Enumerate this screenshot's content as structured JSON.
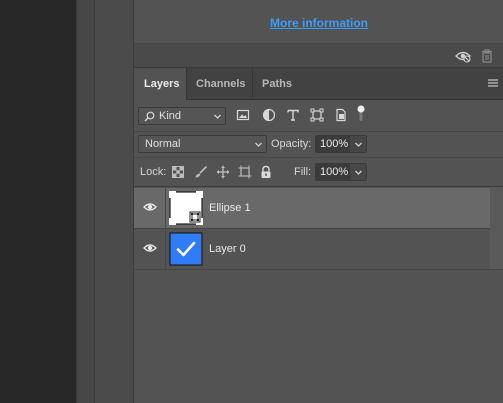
{
  "more_info_link": "More information",
  "tabs": [
    {
      "label": "Layers",
      "active": true
    },
    {
      "label": "Channels",
      "active": false
    },
    {
      "label": "Paths",
      "active": false
    }
  ],
  "filter": {
    "kind_label": "Kind",
    "icons": [
      "image-filter-icon",
      "adjustment-filter-icon",
      "type-filter-icon",
      "shape-filter-icon",
      "smart-object-filter-icon",
      "filter-toggle-icon"
    ]
  },
  "blend": {
    "mode": "Normal",
    "opacity_label": "Opacity:",
    "opacity_value": "100%"
  },
  "lock": {
    "label": "Lock:",
    "fill_label": "Fill:",
    "fill_value": "100%",
    "icons": [
      "lock-transparent-pixels-icon",
      "lock-image-pixels-icon",
      "lock-position-icon",
      "lock-artboard-icon",
      "lock-all-icon"
    ]
  },
  "layers": [
    {
      "name": "Ellipse 1",
      "selected": true,
      "thumb": "shape"
    },
    {
      "name": "Layer 0",
      "selected": false,
      "thumb": "checkmark"
    }
  ],
  "colors": {
    "accent_link": "#3d9bf7",
    "layer_thumb_blue": "#2f7cf6",
    "panel_bg": "#535353",
    "selected_layer_bg": "#696969"
  }
}
